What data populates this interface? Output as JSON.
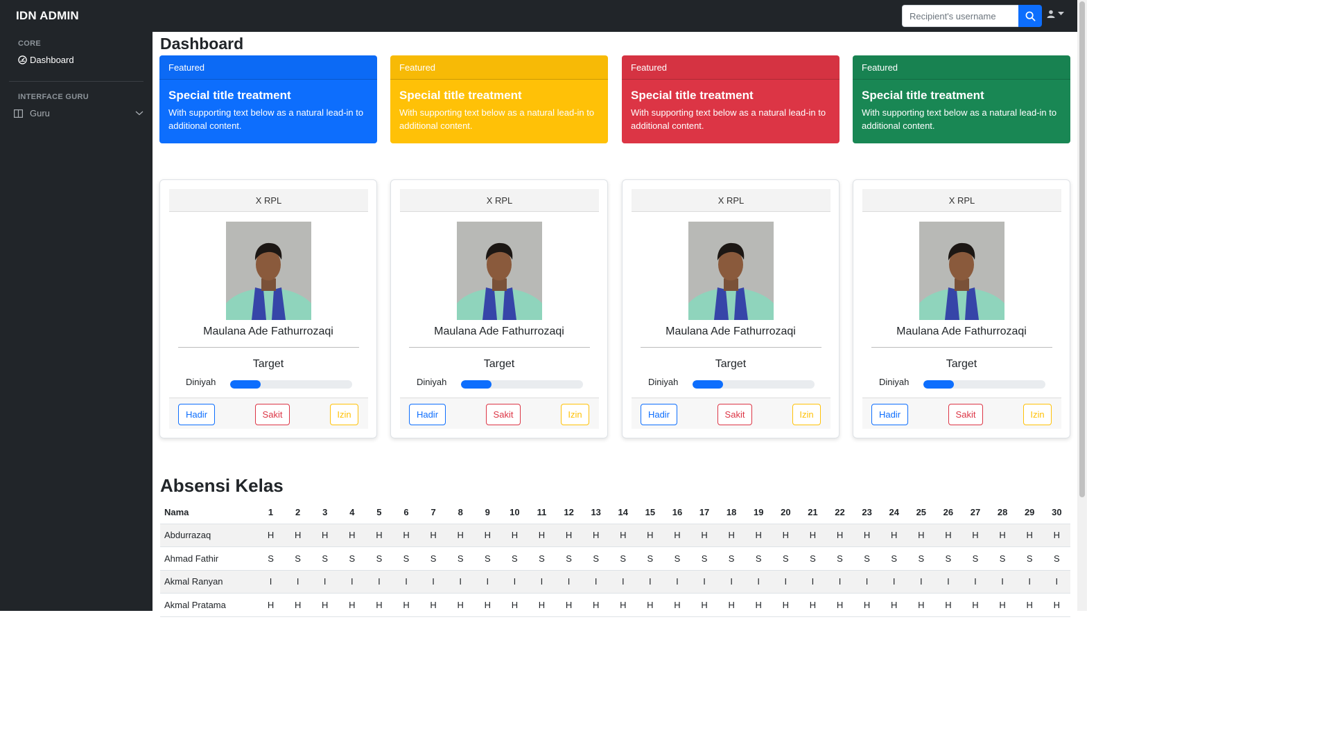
{
  "navbar": {
    "brand": "IDN ADMIN",
    "search_placeholder": "Recipient's username",
    "search_icon": "search-icon",
    "user_icon": "user-icon"
  },
  "sidebar": {
    "core_heading": "CORE",
    "dashboard_label": "Dashboard",
    "interface_heading": "INTERFACE GURU",
    "guru_label": "Guru"
  },
  "main": {
    "title": "Dashboard"
  },
  "feature_cards": [
    {
      "header": "Featured",
      "title": "Special title treatment",
      "text": "With supporting text below as a natural lead-in to additional content.",
      "color": "#0d6efd"
    },
    {
      "header": "Featured",
      "title": "Special title treatment",
      "text": "With supporting text below as a natural lead-in to additional content.",
      "color": "#ffc107"
    },
    {
      "header": "Featured",
      "title": "Special title treatment",
      "text": "With supporting text below as a natural lead-in to additional content.",
      "color": "#dc3545"
    },
    {
      "header": "Featured",
      "title": "Special title treatment",
      "text": "With supporting text below as a natural lead-in to additional content.",
      "color": "#198754"
    }
  ],
  "students": [
    {
      "class": "X RPL",
      "name": "Maulana Ade Fathurrozaqi",
      "target_label": "Target",
      "progress_label": "Diniyah",
      "progress": 0.25,
      "hadir": "Hadir",
      "sakit": "Sakit",
      "izin": "Izin"
    },
    {
      "class": "X RPL",
      "name": "Maulana Ade Fathurrozaqi",
      "target_label": "Target",
      "progress_label": "Diniyah",
      "progress": 0.25,
      "hadir": "Hadir",
      "sakit": "Sakit",
      "izin": "Izin"
    },
    {
      "class": "X RPL",
      "name": "Maulana Ade Fathurrozaqi",
      "target_label": "Target",
      "progress_label": "Diniyah",
      "progress": 0.25,
      "hadir": "Hadir",
      "sakit": "Sakit",
      "izin": "Izin"
    },
    {
      "class": "X RPL",
      "name": "Maulana Ade Fathurrozaqi",
      "target_label": "Target",
      "progress_label": "Diniyah",
      "progress": 0.25,
      "hadir": "Hadir",
      "sakit": "Sakit",
      "izin": "Izin"
    }
  ],
  "attendance": {
    "title": "Absensi Kelas",
    "name_header": "Nama",
    "days": [
      "1",
      "2",
      "3",
      "4",
      "5",
      "6",
      "7",
      "8",
      "9",
      "10",
      "11",
      "12",
      "13",
      "14",
      "15",
      "16",
      "17",
      "18",
      "19",
      "20",
      "21",
      "22",
      "23",
      "24",
      "25",
      "26",
      "27",
      "28",
      "29",
      "30"
    ],
    "rows": [
      {
        "name": "Abdurrazaq",
        "values": [
          "H",
          "H",
          "H",
          "H",
          "H",
          "H",
          "H",
          "H",
          "H",
          "H",
          "H",
          "H",
          "H",
          "H",
          "H",
          "H",
          "H",
          "H",
          "H",
          "H",
          "H",
          "H",
          "H",
          "H",
          "H",
          "H",
          "H",
          "H",
          "H",
          "H"
        ]
      },
      {
        "name": "Ahmad Fathir",
        "values": [
          "S",
          "S",
          "S",
          "S",
          "S",
          "S",
          "S",
          "S",
          "S",
          "S",
          "S",
          "S",
          "S",
          "S",
          "S",
          "S",
          "S",
          "S",
          "S",
          "S",
          "S",
          "S",
          "S",
          "S",
          "S",
          "S",
          "S",
          "S",
          "S",
          "S"
        ]
      },
      {
        "name": "Akmal Ranyan",
        "values": [
          "I",
          "I",
          "I",
          "I",
          "I",
          "I",
          "I",
          "I",
          "I",
          "I",
          "I",
          "I",
          "I",
          "I",
          "I",
          "I",
          "I",
          "I",
          "I",
          "I",
          "I",
          "I",
          "I",
          "I",
          "I",
          "I",
          "I",
          "I",
          "I",
          "I"
        ]
      },
      {
        "name": "Akmal Pratama",
        "values": [
          "H",
          "H",
          "H",
          "H",
          "H",
          "H",
          "H",
          "H",
          "H",
          "H",
          "H",
          "H",
          "H",
          "H",
          "H",
          "H",
          "H",
          "H",
          "H",
          "H",
          "H",
          "H",
          "H",
          "H",
          "H",
          "H",
          "H",
          "H",
          "H",
          "H"
        ]
      }
    ]
  }
}
